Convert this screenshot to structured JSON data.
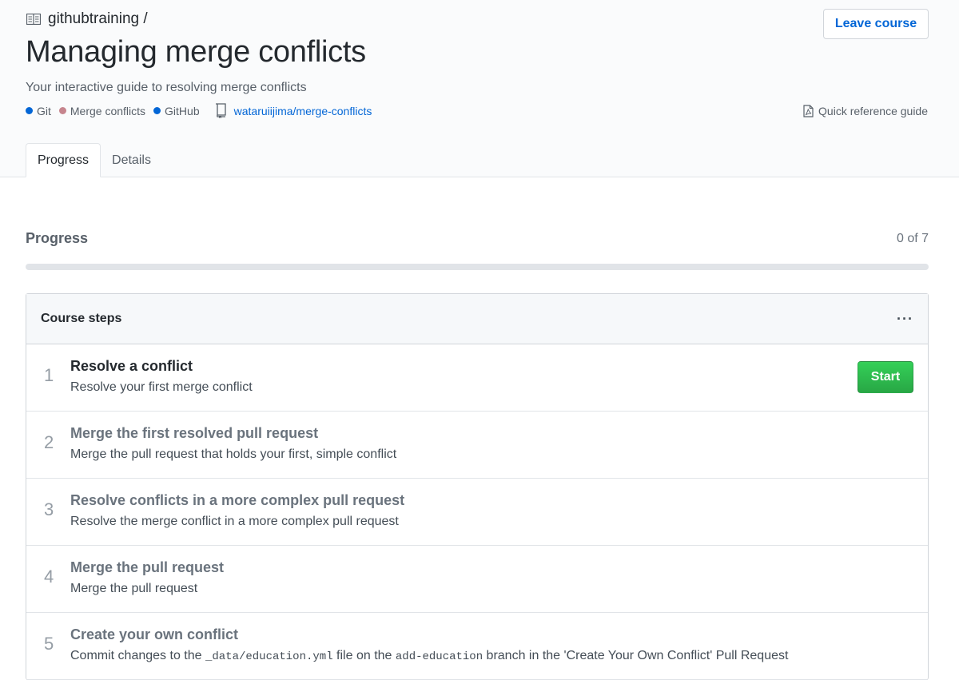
{
  "header": {
    "org": "githubtraining /",
    "title": "Managing merge conflicts",
    "subtitle": "Your interactive guide to resolving merge conflicts",
    "tags": [
      {
        "label": "Git",
        "color": "#0366d6"
      },
      {
        "label": "Merge conflicts",
        "color": "#c6858e"
      },
      {
        "label": "GitHub",
        "color": "#0366d6"
      }
    ],
    "repo_link": "wataruiijima/merge-conflicts",
    "leave_button": "Leave course",
    "quick_reference": "Quick reference guide"
  },
  "tabs": [
    {
      "label": "Progress",
      "active": true
    },
    {
      "label": "Details",
      "active": false
    }
  ],
  "progress": {
    "title": "Progress",
    "count_label": "0 of 7",
    "fraction": 0
  },
  "course_steps": {
    "title": "Course steps",
    "menu_icon": "kebab-horizontal-icon",
    "steps": [
      {
        "number": "1",
        "title": "Resolve a conflict",
        "description": "Resolve your first merge conflict",
        "action": "Start"
      },
      {
        "number": "2",
        "title": "Merge the first resolved pull request",
        "description": "Merge the pull request that holds your first, simple conflict"
      },
      {
        "number": "3",
        "title": "Resolve conflicts in a more complex pull request",
        "description": "Resolve the merge conflict in a more complex pull request"
      },
      {
        "number": "4",
        "title": "Merge the pull request",
        "description": "Merge the pull request"
      },
      {
        "number": "5",
        "title": "Create your own conflict",
        "description_parts": [
          "Commit changes to the ",
          "_data/education.yml",
          " file on the ",
          "add-education",
          " branch in the 'Create Your Own Conflict' Pull Request"
        ]
      }
    ]
  },
  "colors": {
    "link": "#0366d6",
    "start_button": "#2ea44f",
    "muted": "#586069"
  }
}
